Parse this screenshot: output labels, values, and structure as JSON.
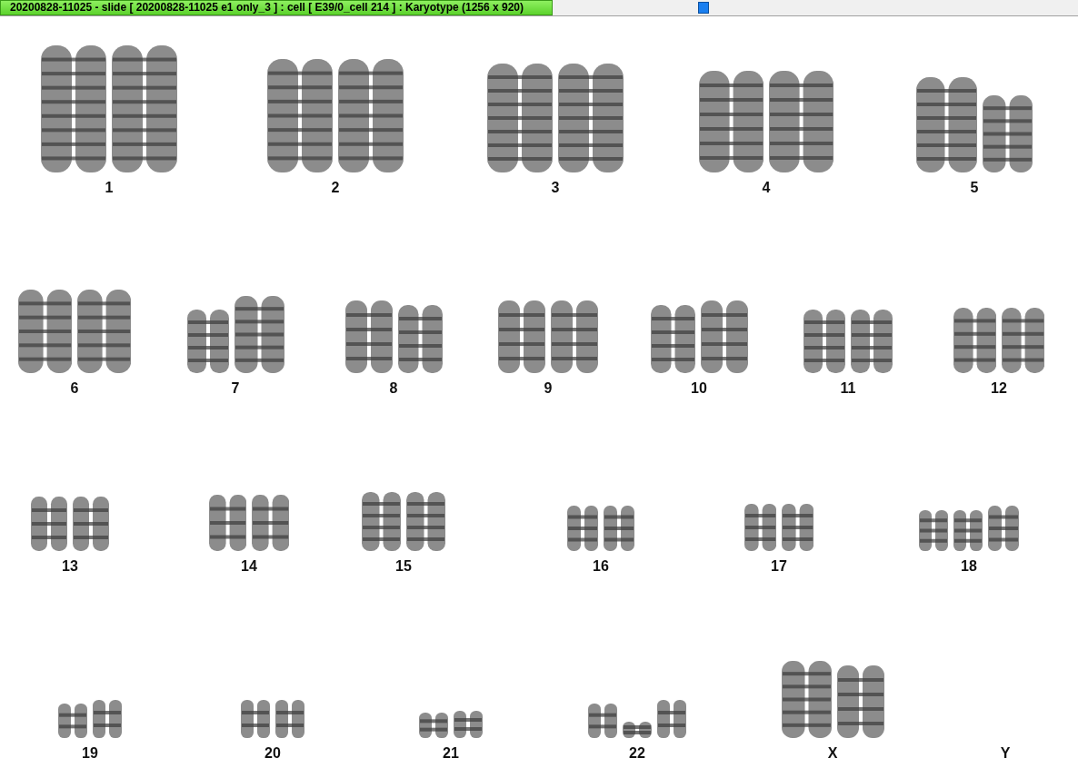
{
  "title_bar": {
    "title": "20200828-11025 - slide [ 20200828-11025 e1 only_3 ] : cell [ E39/0_cell 214 ] : Karyotype  (1256 x 920)"
  },
  "karyotype_rows": [
    {
      "groups": [
        {
          "label": "1"
        },
        {
          "label": "2"
        },
        {
          "label": "3"
        },
        {
          "label": "4"
        },
        {
          "label": "5"
        }
      ]
    },
    {
      "groups": [
        {
          "label": "6"
        },
        {
          "label": "7"
        },
        {
          "label": "8"
        },
        {
          "label": "9"
        },
        {
          "label": "10"
        },
        {
          "label": "11"
        },
        {
          "label": "12"
        }
      ]
    },
    {
      "groups": [
        {
          "label": "13"
        },
        {
          "label": "14"
        },
        {
          "label": "15"
        },
        {
          "label": "16"
        },
        {
          "label": "17"
        },
        {
          "label": "18"
        }
      ]
    },
    {
      "groups": [
        {
          "label": "19"
        },
        {
          "label": "20"
        },
        {
          "label": "21"
        },
        {
          "label": "22"
        },
        {
          "label": "X"
        },
        {
          "label": "Y"
        }
      ]
    }
  ]
}
